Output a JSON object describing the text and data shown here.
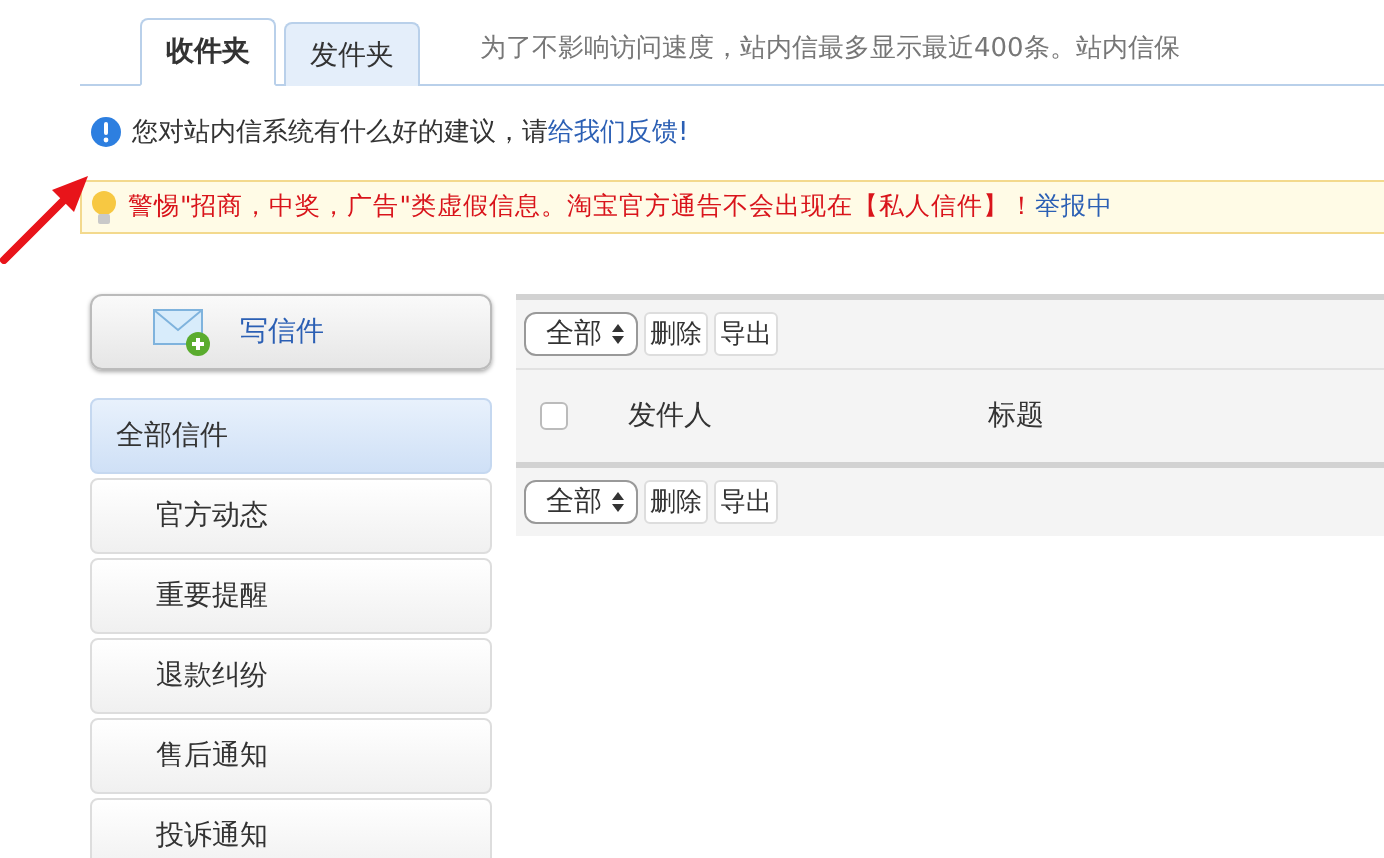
{
  "tabs": [
    {
      "label": "收件夹",
      "selected": true
    },
    {
      "label": "发件夹",
      "selected": false
    }
  ],
  "tab_note": "为了不影响访问速度，站内信最多显示最近400条。站内信保",
  "feedback": {
    "text": "您对站内信系统有什么好的建议，请",
    "link": "给我们反馈!"
  },
  "warning": {
    "text": "警惕\"招商，中奖，广告\"类虚假信息。淘宝官方通告不会出现在【私人信件】！",
    "link": "举报中"
  },
  "compose_button": "写信件",
  "folders": [
    {
      "label": "全部信件",
      "selected": true,
      "children": [
        {
          "label": "官方动态",
          "selected": false
        },
        {
          "label": "重要提醒",
          "selected": false
        },
        {
          "label": "退款纠纷",
          "selected": false
        },
        {
          "label": "售后通知",
          "selected": false
        },
        {
          "label": "投诉通知",
          "selected": false
        }
      ]
    }
  ],
  "toolbars": [
    {
      "filter": "全部",
      "buttons": [
        "删除",
        "导出"
      ]
    },
    {
      "filter": "全部",
      "buttons": [
        "删除",
        "导出"
      ]
    }
  ],
  "table": {
    "select_all_checked": false,
    "columns": [
      "发件人",
      "标题"
    ]
  }
}
